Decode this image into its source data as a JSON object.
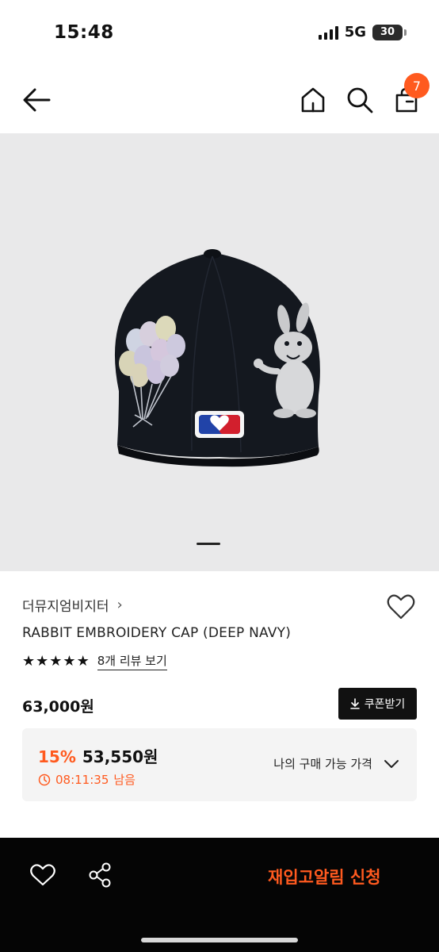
{
  "status": {
    "time": "15:48",
    "network": "5G",
    "battery": "30"
  },
  "nav": {
    "cart_count": "7"
  },
  "product": {
    "brand": "더뮤지엄비지터",
    "brand_chevron": "›",
    "name": "RABBIT EMBROIDERY CAP (DEEP NAVY)",
    "rating_stars": 5,
    "review_link": "8개 리뷰 보기",
    "original_price": "63,000원",
    "coupon_label": "쿠폰받기",
    "sale_percent": "15%",
    "sale_price": "53,550원",
    "timer": "08:11:35",
    "timer_suffix": "남음",
    "price_check_label": "나의 구매 가능 가격"
  },
  "bottom": {
    "restock_label": "재입고알림 신청"
  },
  "colors": {
    "accent": "#ff5a1f",
    "bar": "#050505"
  },
  "icons": [
    "back-arrow-icon",
    "home-icon",
    "search-icon",
    "shopping-bag-icon",
    "heart-icon",
    "star-icon",
    "download-icon",
    "clock-icon",
    "chevron-down-icon",
    "share-icon"
  ]
}
